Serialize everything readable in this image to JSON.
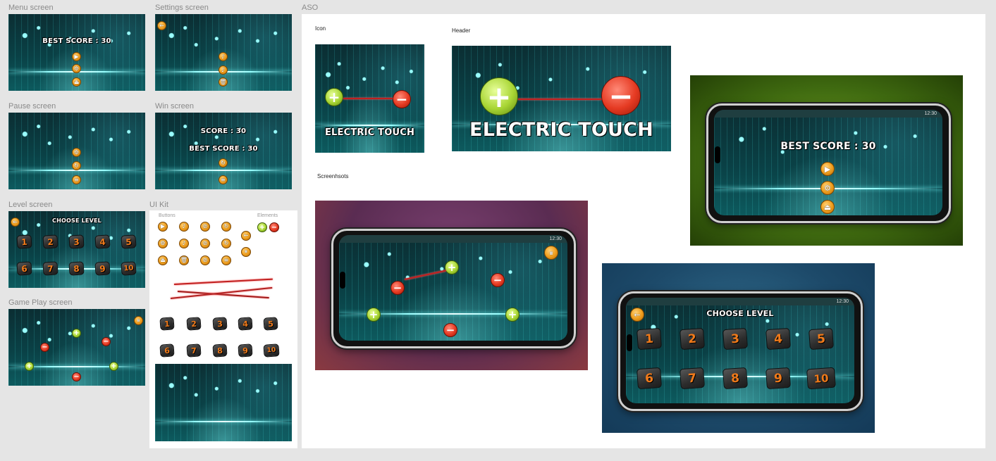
{
  "canvas_labels": {
    "menu": "Menu screen",
    "settings": "Settings screen",
    "pause": "Pause screen",
    "win": "Win screen",
    "level": "Level screen",
    "uikit": "UI Kit",
    "gameplay": "Game Play screen",
    "aso": "ASO"
  },
  "menu_screen": {
    "best_score": "BEST SCORE : 30"
  },
  "win_screen": {
    "score": "SCORE : 30",
    "best_score": "BEST SCORE : 30"
  },
  "level_screen": {
    "title": "CHOOSE LEVEL",
    "levels": [
      "1",
      "2",
      "3",
      "4",
      "5",
      "6",
      "7",
      "8",
      "9",
      "10"
    ]
  },
  "uikit": {
    "buttons_label": "Buttons",
    "elements_label": "Elements",
    "levels": [
      "1",
      "2",
      "3",
      "4",
      "5",
      "6",
      "7",
      "8",
      "9",
      "10"
    ]
  },
  "aso": {
    "icon_label": "Icon",
    "header_label": "Header",
    "screenshots_label": "Screenhsots",
    "app_name": "ELECTRIC TOUCH",
    "phone_time": "12:30",
    "best_score": "BEST SCORE : 30",
    "choose_level": "CHOOSE LEVEL",
    "levels": [
      "1",
      "2",
      "3",
      "4",
      "5",
      "6",
      "7",
      "8",
      "9",
      "10"
    ]
  },
  "icons": {
    "play": "▶",
    "settings": "⚙",
    "exit": "⏏",
    "sound": "♪",
    "no_sound": "⊘",
    "delete": "🗑",
    "pause": "⏸",
    "restart": "↻",
    "list": "≡",
    "back": "←",
    "plus": "+",
    "minus": "−"
  },
  "colors": {
    "accent_orange": "#f0a020",
    "plus_green": "#a8d534",
    "minus_red": "#e53a22",
    "screen_teal": "#0a4146"
  }
}
